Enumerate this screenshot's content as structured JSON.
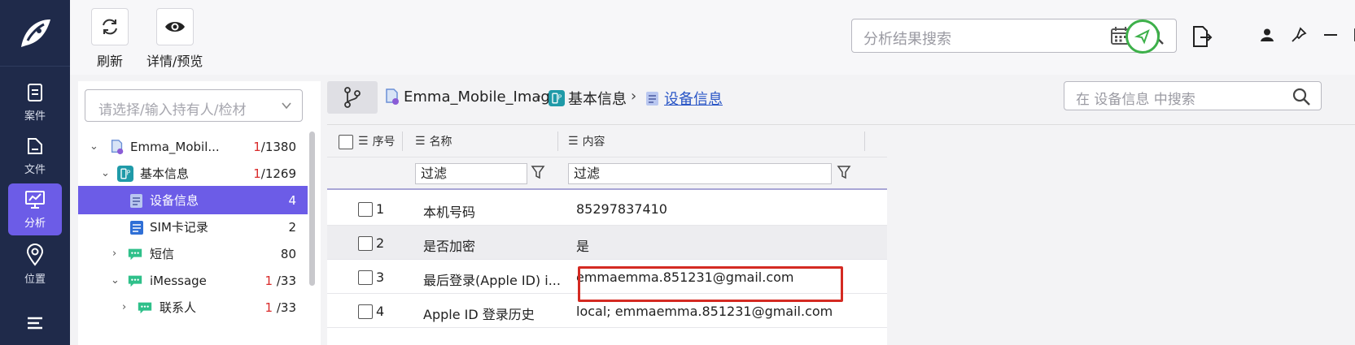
{
  "nav": {
    "items": [
      {
        "label": "案件",
        "icon": "clipboard-icon"
      },
      {
        "label": "文件",
        "icon": "file-icon"
      },
      {
        "label": "分析",
        "icon": "monitor-chart-icon",
        "active": true
      },
      {
        "label": "位置",
        "icon": "location-pin-icon"
      },
      {
        "label": "",
        "icon": "list-icon"
      }
    ]
  },
  "toolbar": {
    "refresh_label": "刷新",
    "details_label": "详情/预览",
    "search_placeholder": "分析结果搜索"
  },
  "tree": {
    "combo_placeholder": "请选择/输入持有人/检材",
    "rows": [
      {
        "label": "Emma_Mobil...",
        "count_red": "1",
        "count_rest": "/1380"
      },
      {
        "label": "基本信息",
        "count_red": "1",
        "count_rest": "/1269"
      },
      {
        "label": "设备信息",
        "count_red": "",
        "count_rest": "4"
      },
      {
        "label": "SIM卡记录",
        "count_red": "",
        "count_rest": "2"
      },
      {
        "label": "短信",
        "count_red": "",
        "count_rest": "80"
      },
      {
        "label": "iMessage",
        "count_red": "1",
        "count_rest": " /33"
      },
      {
        "label": "联系人",
        "count_red": "1",
        "count_rest": " /33"
      }
    ]
  },
  "breadcrumb": {
    "items": [
      "Emma_Mobile_Image",
      "基本信息",
      "设备信息"
    ],
    "separator": "›",
    "search_placeholder": "在 设备信息 中搜索"
  },
  "grid": {
    "columns": [
      "序号",
      "名称",
      "内容"
    ],
    "filter_placeholder": "过滤",
    "rows": [
      {
        "num": "1",
        "name": "本机号码",
        "content": "85297837410"
      },
      {
        "num": "2",
        "name": "是否加密",
        "content": "是"
      },
      {
        "num": "3",
        "name": "最后登录(Apple ID) i...",
        "content": "emmaemma.851231@gmail.com"
      },
      {
        "num": "4",
        "name": "Apple ID 登录历史",
        "content": "local; emmaemma.851231@gmail.com"
      }
    ]
  },
  "colors": {
    "nav_bg": "#1f2a4a",
    "accent": "#6c5ce7",
    "highlight_red": "#d42a22",
    "status_green": "#3db04a"
  }
}
